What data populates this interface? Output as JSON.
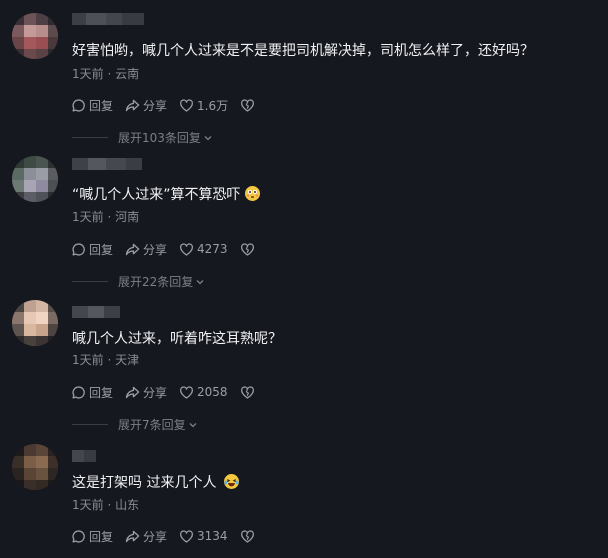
{
  "colors": {
    "background": "#16181f",
    "text": "#f2f2f4",
    "muted": "#8a8c93",
    "icon": "#9c9ea5"
  },
  "comments": [
    {
      "text": "好害怕哟，喊几个人过来是不是要把司机解决掉，司机怎么样了，还好吗？",
      "time_location": "1天前 · 云南",
      "reply_label": "回复",
      "share_label": "分享",
      "likes": "1.6万",
      "expand_label": "展开103条回复"
    },
    {
      "text": "“喊几个人过来”算不算恐吓",
      "emoji": "flushed-face-emoji",
      "time_location": "1天前 · 河南",
      "reply_label": "回复",
      "share_label": "分享",
      "likes": "4273",
      "expand_label": "展开22条回复"
    },
    {
      "text": "喊几个人过来，听着咋这耳熟呢？",
      "time_location": "1天前 · 天津",
      "reply_label": "回复",
      "share_label": "分享",
      "likes": "2058",
      "expand_label": "展开7条回复"
    },
    {
      "text": "这是打架吗 过来几个人",
      "emoji": "laughing-tears-emoji",
      "time_location": "1天前 · 山东",
      "reply_label": "回复",
      "share_label": "分享",
      "likes": "3134"
    }
  ]
}
